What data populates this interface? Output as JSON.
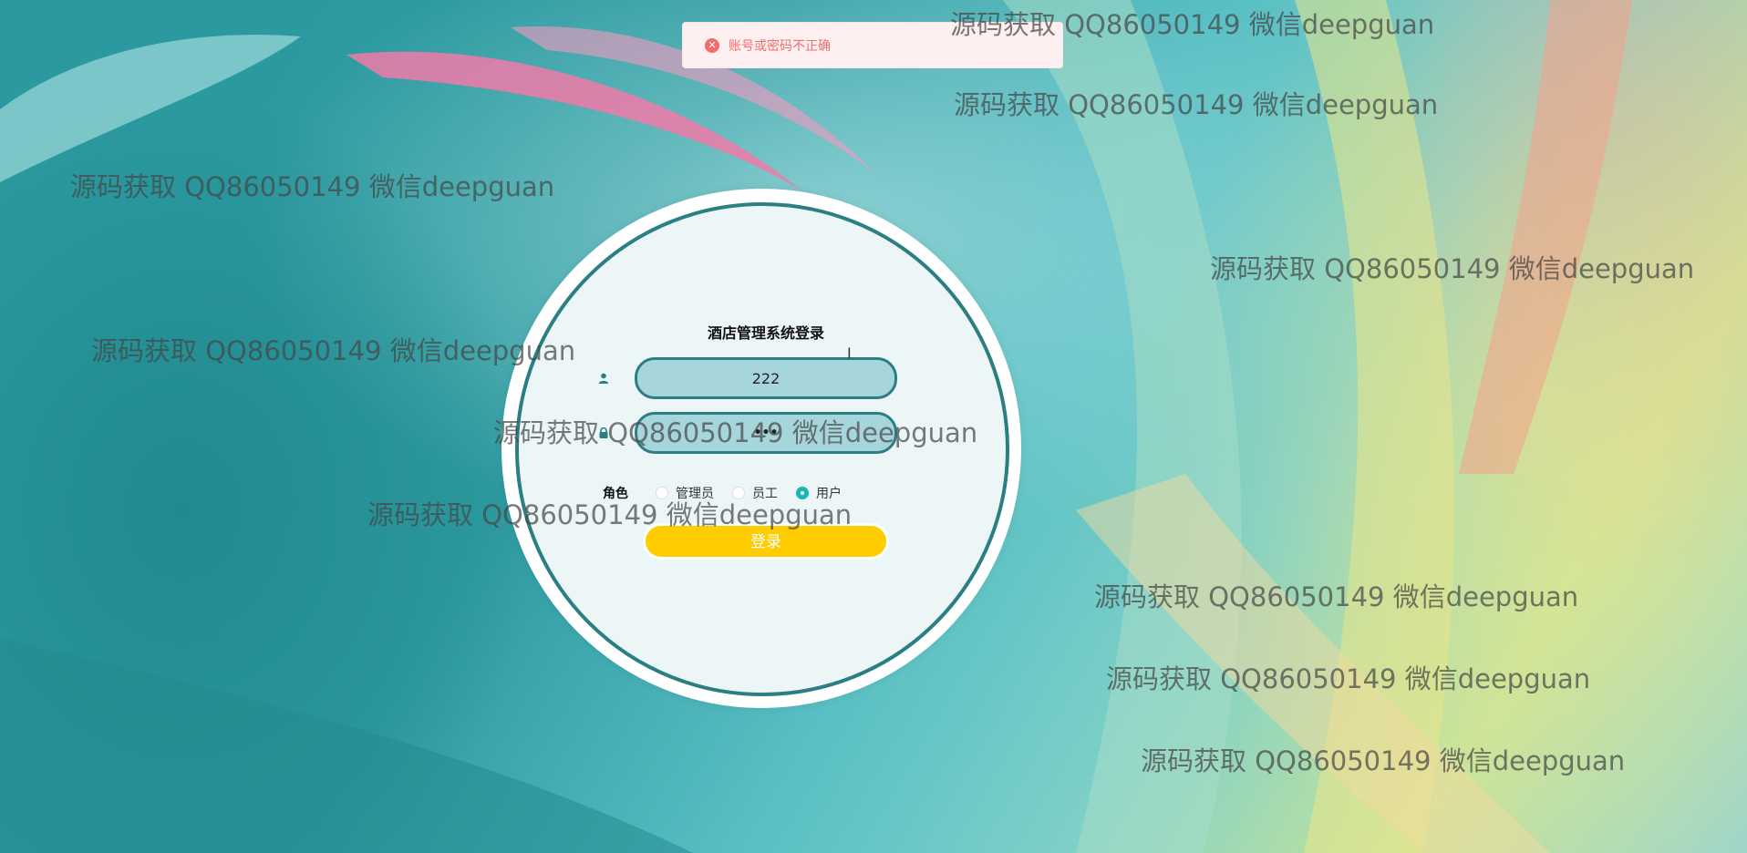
{
  "colors": {
    "primary_teal": "#2b7f83",
    "input_fill": "#a6d6dc",
    "button_yellow": "#ffcc00",
    "radio_checked": "#1bb5b7",
    "error_red": "#f56c6c",
    "error_bg": "#fef0f0"
  },
  "toast": {
    "icon": "error-circle-icon",
    "message": "账号或密码不正确"
  },
  "login": {
    "title": "酒店管理系统登录",
    "username": {
      "icon": "user-icon",
      "value": "222"
    },
    "password": {
      "icon": "lock-icon",
      "value": "•••"
    },
    "role": {
      "label": "角色",
      "options": [
        {
          "label": "管理员",
          "checked": false
        },
        {
          "label": "员工",
          "checked": false
        },
        {
          "label": "用户",
          "checked": true
        }
      ]
    },
    "submit_label": "登录"
  },
  "watermark_text": "源码获取 QQ86050149 微信deepguan"
}
